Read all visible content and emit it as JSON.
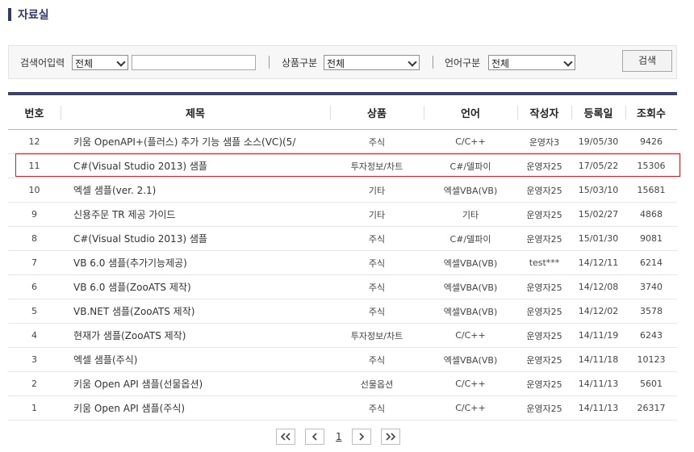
{
  "page": {
    "title": "자료실"
  },
  "search": {
    "keyword_label": "검색어입력",
    "keyword_scope": "전체",
    "keyword_value": "",
    "product_label": "상품구분",
    "product_value": "전체",
    "language_label": "언어구분",
    "language_value": "전체",
    "button_label": "검색"
  },
  "table": {
    "headers": [
      "번호",
      "제목",
      "상품",
      "언어",
      "작성자",
      "등록일",
      "조회수"
    ],
    "rows": [
      {
        "no": "12",
        "title": "키움 OpenAPI+(플러스) 추가 기능 샘플 소스(VC)(5/",
        "product": "주식",
        "lang": "C/C++",
        "author": "운영자3",
        "date": "19/05/30",
        "views": "9426"
      },
      {
        "no": "11",
        "title": "C#(Visual Studio 2013) 샘플",
        "product": "투자정보/차트",
        "lang": "C#/델파이",
        "author": "운영자25",
        "date": "17/05/22",
        "views": "15306"
      },
      {
        "no": "10",
        "title": "엑셀 샘플(ver. 2.1)",
        "product": "기타",
        "lang": "엑셀VBA(VB)",
        "author": "운영자25",
        "date": "15/03/10",
        "views": "15681"
      },
      {
        "no": "9",
        "title": "신용주문 TR 제공 가이드",
        "product": "기타",
        "lang": "기타",
        "author": "운영자25",
        "date": "15/02/27",
        "views": "4868"
      },
      {
        "no": "8",
        "title": "C#(Visual Studio 2013) 샘플",
        "product": "주식",
        "lang": "C#/델파이",
        "author": "운영자25",
        "date": "15/01/30",
        "views": "9081"
      },
      {
        "no": "7",
        "title": "VB 6.0 샘플(추가기능제공)",
        "product": "주식",
        "lang": "엑셀VBA(VB)",
        "author": "test***",
        "date": "14/12/11",
        "views": "6214"
      },
      {
        "no": "6",
        "title": "VB 6.0 샘플(ZooATS 제작)",
        "product": "주식",
        "lang": "엑셀VBA(VB)",
        "author": "운영자25",
        "date": "14/12/08",
        "views": "3740"
      },
      {
        "no": "5",
        "title": "VB.NET 샘플(ZooATS 제작)",
        "product": "주식",
        "lang": "엑셀VBA(VB)",
        "author": "운영자25",
        "date": "14/12/02",
        "views": "3578"
      },
      {
        "no": "4",
        "title": "현재가 샘플(ZooATS 제작)",
        "product": "투자정보/차트",
        "lang": "C/C++",
        "author": "운영자25",
        "date": "14/11/19",
        "views": "6243"
      },
      {
        "no": "3",
        "title": "엑셀 샘플(주식)",
        "product": "주식",
        "lang": "엑셀VBA(VB)",
        "author": "운영자25",
        "date": "14/11/18",
        "views": "10123"
      },
      {
        "no": "2",
        "title": "키움 Open API 샘플(선물옵션)",
        "product": "선물옵션",
        "lang": "C/C++",
        "author": "운영자25",
        "date": "14/11/13",
        "views": "5601"
      },
      {
        "no": "1",
        "title": "키움 Open API 샘플(주식)",
        "product": "주식",
        "lang": "C/C++",
        "author": "운영자25",
        "date": "14/11/13",
        "views": "26317"
      }
    ]
  },
  "pagination": {
    "current_page": "1"
  },
  "colors": {
    "accent": "#2c3a6e",
    "highlight": "#d71e26"
  }
}
